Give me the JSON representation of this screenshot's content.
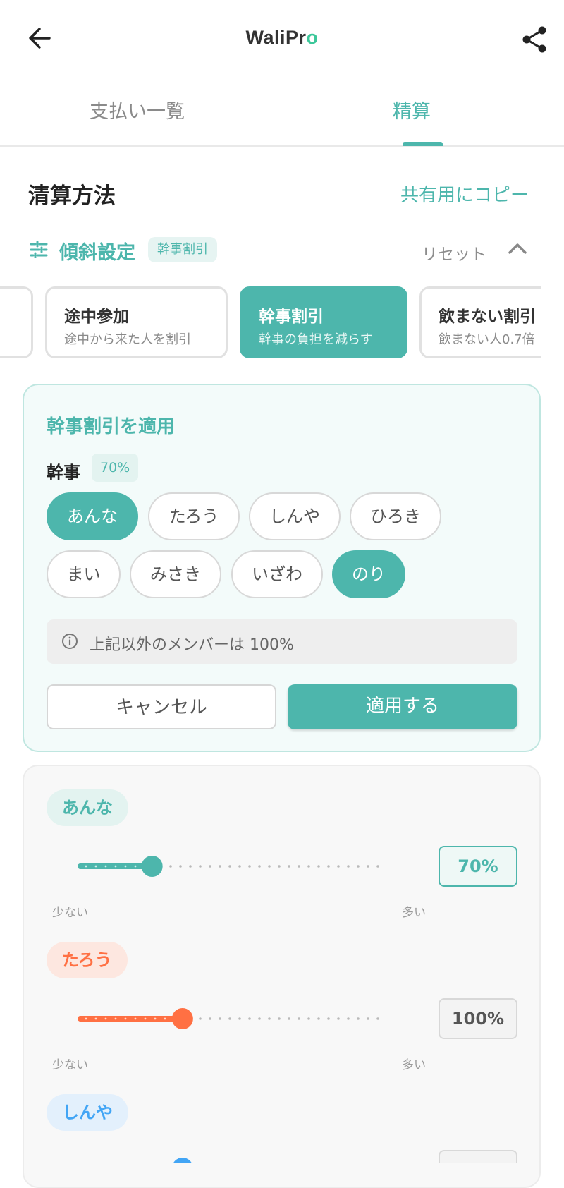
{
  "header": {
    "logo_text": "WaliPro",
    "logo_main": "WaliPr",
    "logo_accent": "o"
  },
  "tabs": [
    {
      "label": "支払い一覧"
    },
    {
      "label": "精算"
    }
  ],
  "section": {
    "title": "清算方法",
    "copy_link": "共有用にコピー"
  },
  "tilt": {
    "title": "傾斜設定",
    "badge": "幹事割引",
    "reset": "リセット"
  },
  "presets": [
    {
      "title": "途中参加",
      "subtitle": "途中から来た人を割引"
    },
    {
      "title": "幹事割引",
      "subtitle": "幹事の負担を減らす",
      "selected": true
    },
    {
      "title": "飲まない割引",
      "subtitle": "飲まない人0.7倍"
    }
  ],
  "apply_panel": {
    "title": "幹事割引を適用",
    "role_label": "幹事",
    "role_percent": "70%",
    "members": [
      {
        "name": "あんな",
        "selected": true
      },
      {
        "name": "たろう",
        "selected": false
      },
      {
        "name": "しんや",
        "selected": false
      },
      {
        "name": "ひろき",
        "selected": false
      },
      {
        "name": "まい",
        "selected": false
      },
      {
        "name": "みさき",
        "selected": false
      },
      {
        "name": "いざわ",
        "selected": false
      },
      {
        "name": "のり",
        "selected": true
      }
    ],
    "info": "上記以外のメンバーは 100%",
    "cancel_label": "キャンセル",
    "apply_label": "適用する"
  },
  "sliders": [
    {
      "name": "あんな",
      "percent_text": "70%",
      "level": 0.24,
      "color": "#4db6ac",
      "chip_bg": "#e3f3f0",
      "low_label": "少ない",
      "high_label": "多い"
    },
    {
      "name": "たろう",
      "percent_text": "100%",
      "level": 0.34,
      "color": "#ff7043",
      "chip_bg": "#fde7e0",
      "low_label": "少ない",
      "high_label": "多い"
    },
    {
      "name": "しんや",
      "percent_text": "",
      "level": 0.34,
      "color": "#42a5f5",
      "chip_bg": "#e3f0fc"
    }
  ],
  "colors": {
    "accent": "#4db6ac",
    "orange": "#ff7043",
    "blue": "#42a5f5"
  }
}
